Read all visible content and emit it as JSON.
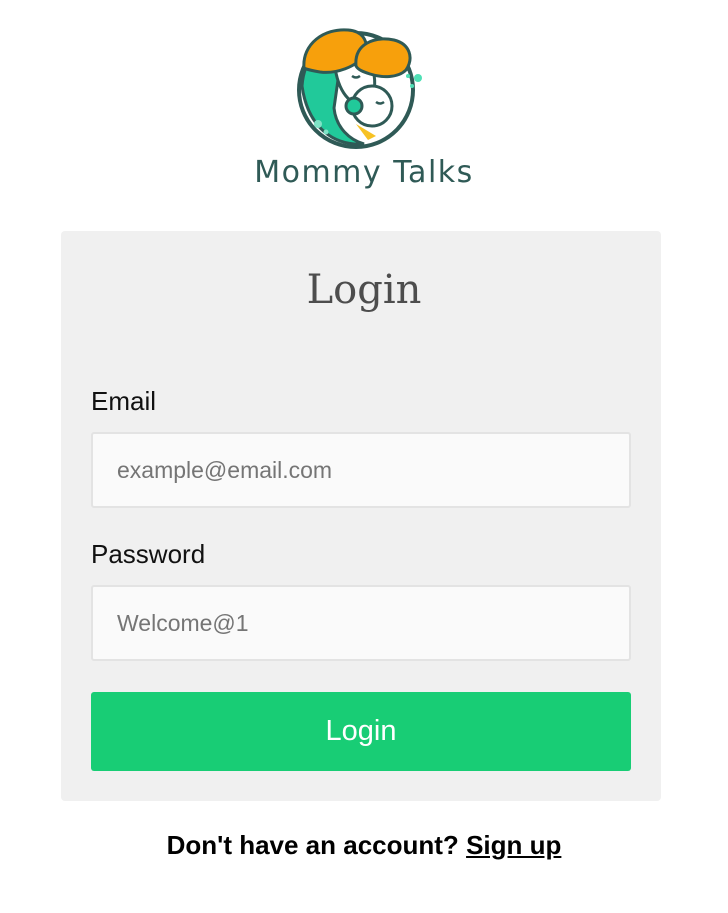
{
  "brand": {
    "name": "Mommy Talks",
    "logo_icon": "mother-baby-logo-icon"
  },
  "login_form": {
    "title": "Login",
    "email": {
      "label": "Email",
      "placeholder": "example@email.com",
      "value": ""
    },
    "password": {
      "label": "Password",
      "placeholder": "Welcome@1",
      "value": ""
    },
    "submit_label": "Login"
  },
  "signup_prompt": {
    "text": "Don't have an account?",
    "link_label": "Sign up"
  },
  "colors": {
    "primary_button": "#18cd75",
    "card_background": "#f0f0f0",
    "brand_text": "#2f5a56",
    "logo_teal": "#21c99a",
    "logo_orange": "#f7a00c"
  }
}
